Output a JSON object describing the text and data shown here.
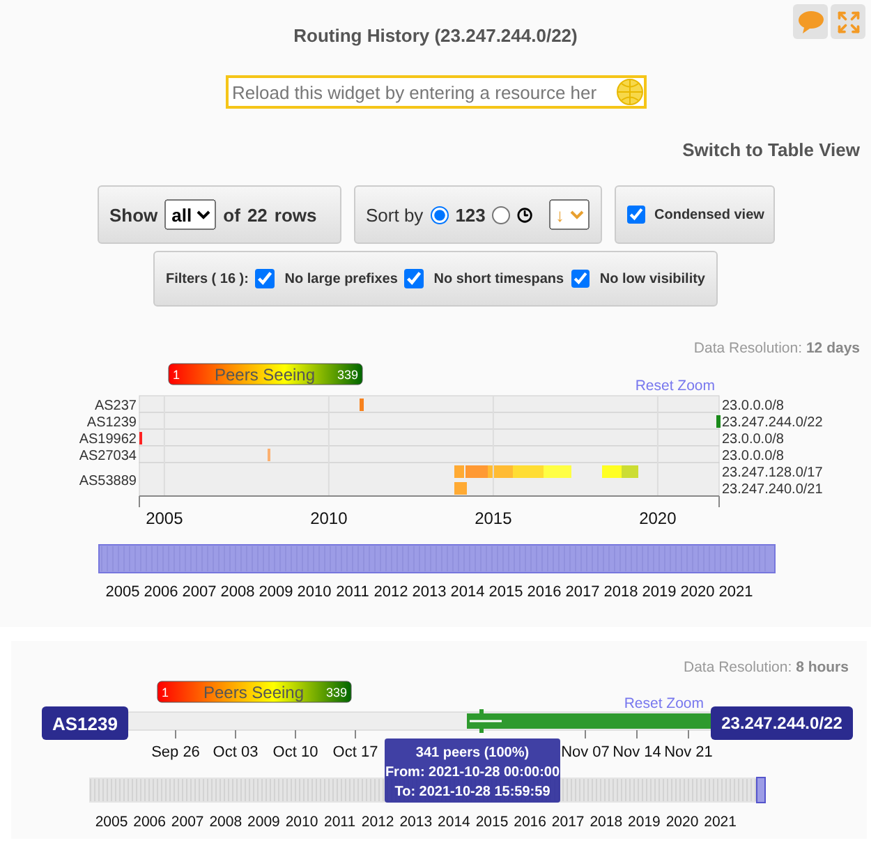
{
  "title": "Routing History (23.247.244.0/22)",
  "resource_input": {
    "placeholder": "Reload this widget by entering a resource her"
  },
  "switch_view_link": "Switch to Table View",
  "show_control": {
    "label": "Show",
    "value": "all",
    "of": "of",
    "count": "22",
    "unit": "rows"
  },
  "sort_control": {
    "label": "Sort by",
    "options": [
      {
        "kind": "number",
        "label": "123",
        "selected": true
      },
      {
        "kind": "clock",
        "selected": false
      }
    ],
    "direction": "↓"
  },
  "condensed_view": {
    "label": "Condensed view",
    "checked": true
  },
  "filters": {
    "label": "Filters ( 16 ):",
    "items": [
      {
        "label": "No large prefixes",
        "checked": true
      },
      {
        "label": "No short timespans",
        "checked": true
      },
      {
        "label": "No low visibility",
        "checked": true
      }
    ]
  },
  "overview_chart": {
    "resolution_label": "Data Resolution:",
    "resolution": "12 days",
    "legend": {
      "min": "1",
      "title": "Peers Seeing",
      "max": "339"
    },
    "reset_zoom": "Reset Zoom",
    "rows": [
      {
        "asn": "AS237",
        "prefixes": [
          "23.0.0.0/8"
        ]
      },
      {
        "asn": "AS1239",
        "prefixes": [
          "23.247.244.0/22"
        ]
      },
      {
        "asn": "AS19962",
        "prefixes": [
          "23.0.0.0/8"
        ]
      },
      {
        "asn": "AS27034",
        "prefixes": [
          "23.0.0.0/8"
        ]
      },
      {
        "asn": "AS53889",
        "prefixes": [
          "23.247.128.0/17",
          "23.247.240.0/21"
        ]
      }
    ],
    "axis_labels": [
      "2005",
      "2010",
      "2015",
      "2020"
    ],
    "navigator_labels": [
      "2005",
      "2006",
      "2007",
      "2008",
      "2009",
      "2010",
      "2011",
      "2012",
      "2013",
      "2014",
      "2015",
      "2016",
      "2017",
      "2018",
      "2019",
      "2020",
      "2021"
    ]
  },
  "detail_chart": {
    "resolution_label": "Data Resolution:",
    "resolution": "8 hours",
    "legend": {
      "min": "1",
      "title": "Peers Seeing",
      "max": "339"
    },
    "reset_zoom": "Reset Zoom",
    "asn": "AS1239",
    "prefix": "23.247.244.0/22",
    "axis_labels": [
      "Sep 26",
      "Oct 03",
      "Oct 10",
      "Oct 17",
      "Nov 07",
      "Nov 14",
      "Nov 21"
    ],
    "tooltip": [
      "341 peers (100%)",
      "From: 2021-10-28 00:00:00",
      "To: 2021-10-28 15:59:59"
    ],
    "navigator_labels": [
      "2005",
      "2006",
      "2007",
      "2008",
      "2009",
      "2010",
      "2011",
      "2012",
      "2013",
      "2014",
      "2015",
      "2016",
      "2017",
      "2018",
      "2019",
      "2020",
      "2021"
    ]
  }
}
